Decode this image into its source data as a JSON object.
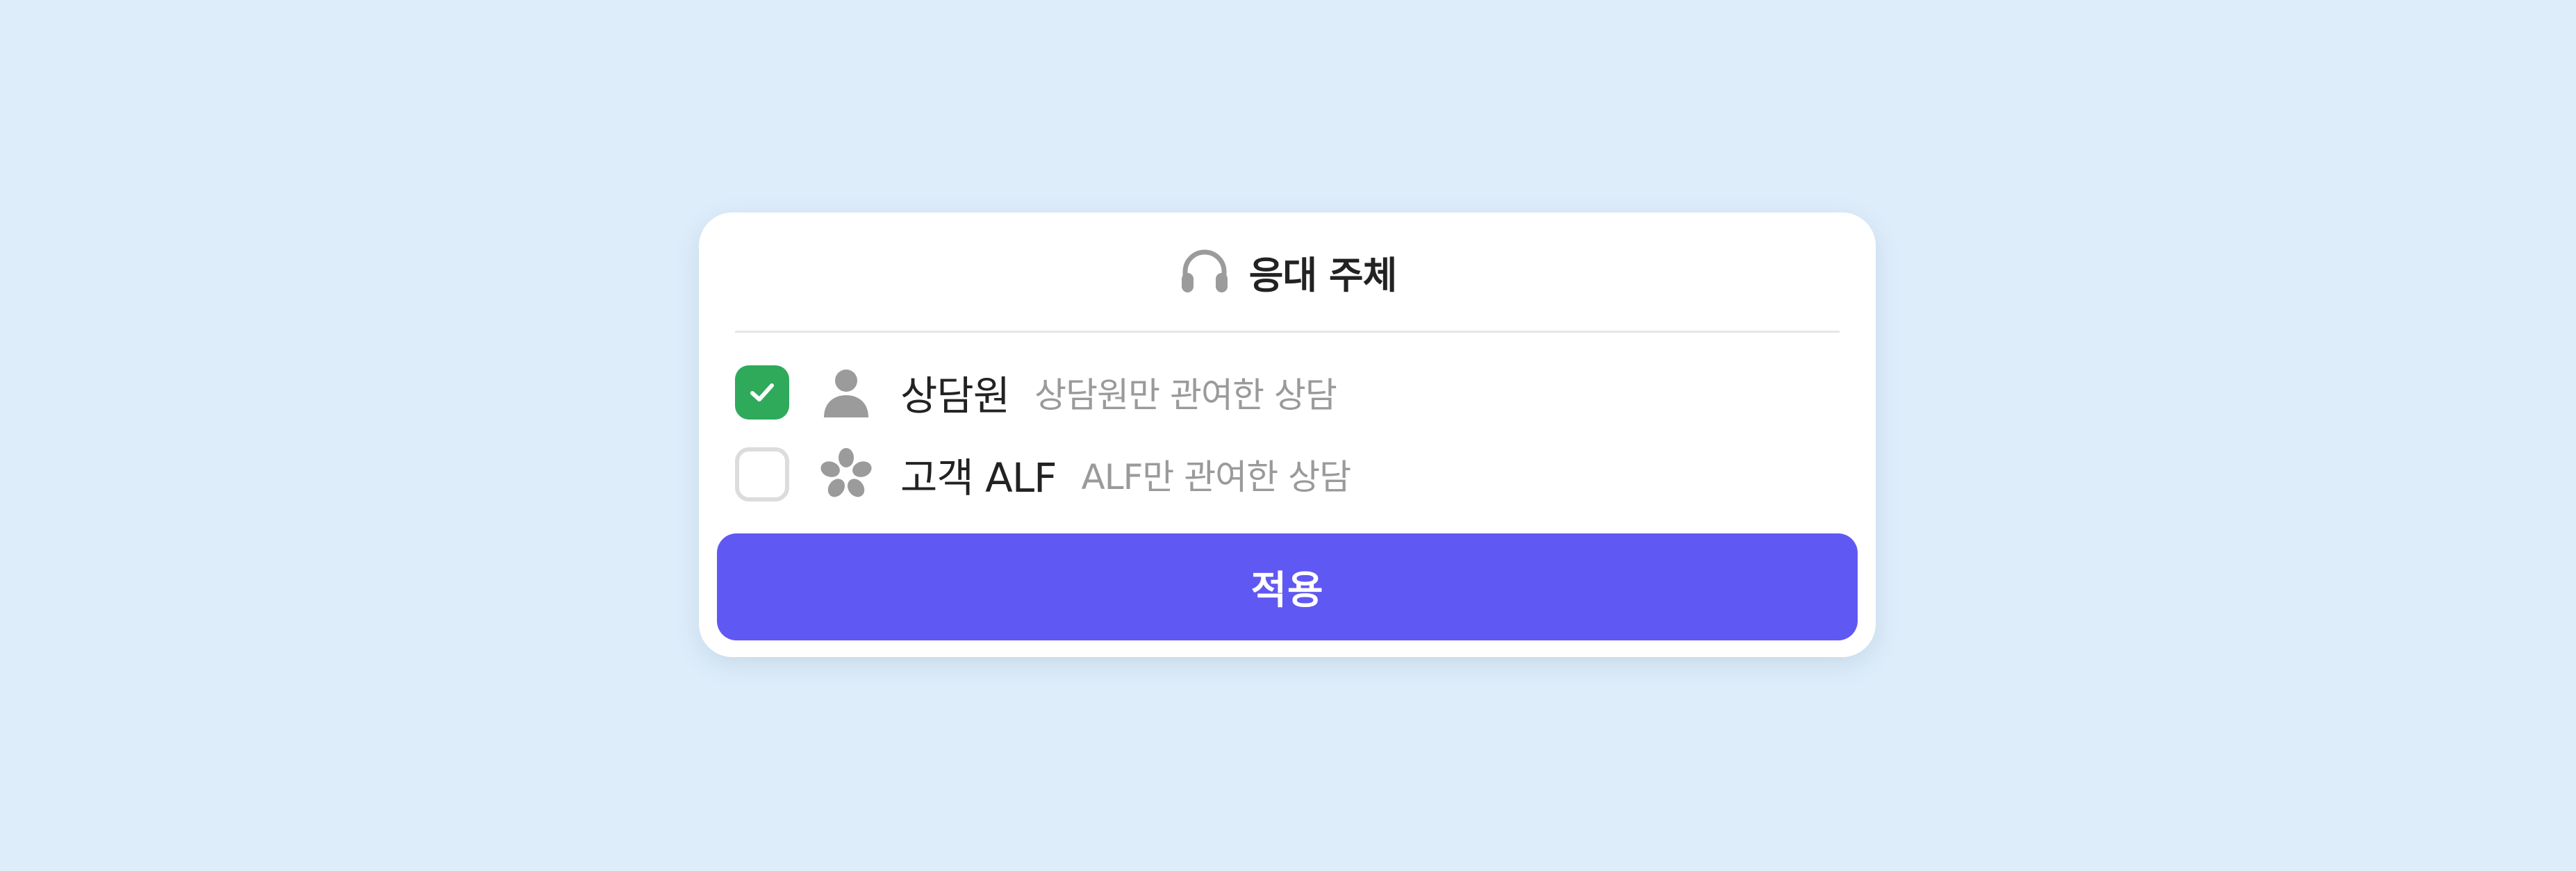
{
  "panel": {
    "title": "응대 주체",
    "title_icon": "headphones-icon"
  },
  "options": [
    {
      "label": "상담원",
      "description": "상담원만 관여한 상담",
      "checked": true,
      "icon": "person-icon"
    },
    {
      "label": "고객 ALF",
      "description": "ALF만 관여한 상담",
      "checked": false,
      "icon": "flower-icon"
    }
  ],
  "apply_button": {
    "label": "적용"
  },
  "colors": {
    "background": "#deedfa",
    "checkbox_checked": "#2eaa5a",
    "button": "#6058f2",
    "icon_gray": "#9b9b9b"
  }
}
